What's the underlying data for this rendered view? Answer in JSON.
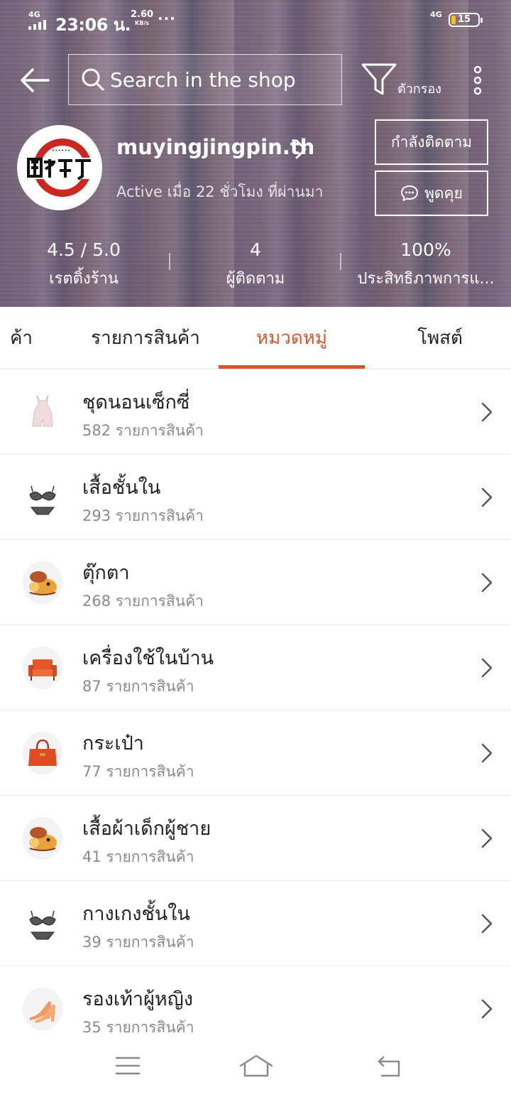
{
  "status_bar": {
    "network_left": "4G",
    "time": "23:06 น.",
    "speed_value": "2.60",
    "speed_unit": "KB/s",
    "more": "···",
    "network_right": "4G",
    "battery": "15",
    "battery_color": "#f5c21b"
  },
  "search": {
    "placeholder": "Search in the shop"
  },
  "filter": {
    "label": "ตัวกรอง"
  },
  "shop": {
    "name": "muyingjingpin.th",
    "active_status": "Active เมื่อ 22 ชั่วโมง ที่ผ่านมา",
    "follow_label": "กำลังติดตาม",
    "chat_label": "พูดคุย"
  },
  "stats": [
    {
      "value": "4.5 / 5.0",
      "label": "เรตติ้งร้าน"
    },
    {
      "value": "4",
      "label": "ผู้ติดตาม"
    },
    {
      "value": "100%",
      "label": "ประสิทธิภาพการแ..."
    }
  ],
  "tabs": [
    {
      "label": "ค้า"
    },
    {
      "label": "รายการสินค้า"
    },
    {
      "label": "หมวดหมู่",
      "active": true
    },
    {
      "label": "โพสต์"
    }
  ],
  "categories": [
    {
      "name": "ชุดนอนเซ็กซี่",
      "count": "582 รายการสินค้า",
      "icon": "sleepwear-icon"
    },
    {
      "name": "เสื้อชั้นใน",
      "count": "293 รายการสินค้า",
      "icon": "bra-icon"
    },
    {
      "name": "ตุ๊กตา",
      "count": "268 รายการสินค้า",
      "icon": "toy-icon"
    },
    {
      "name": "เครื่องใช้ในบ้าน",
      "count": "87 รายการสินค้า",
      "icon": "armchair-icon"
    },
    {
      "name": "กระเป๋า",
      "count": "77 รายการสินค้า",
      "icon": "handbag-icon"
    },
    {
      "name": "เสื้อผ้าเด็กผู้ชาย",
      "count": "41 รายการสินค้า",
      "icon": "toy-icon"
    },
    {
      "name": "กางเกงชั้นใน",
      "count": "39 รายการสินค้า",
      "icon": "lingerie-set-icon"
    },
    {
      "name": "รองเท้าผู้หญิง",
      "count": "35 รายการสินค้า",
      "icon": "high-heels-icon"
    }
  ],
  "colors": {
    "accent": "#d4582f",
    "header_overlay": "#624e6c",
    "muted_text": "#8a8a8a"
  }
}
